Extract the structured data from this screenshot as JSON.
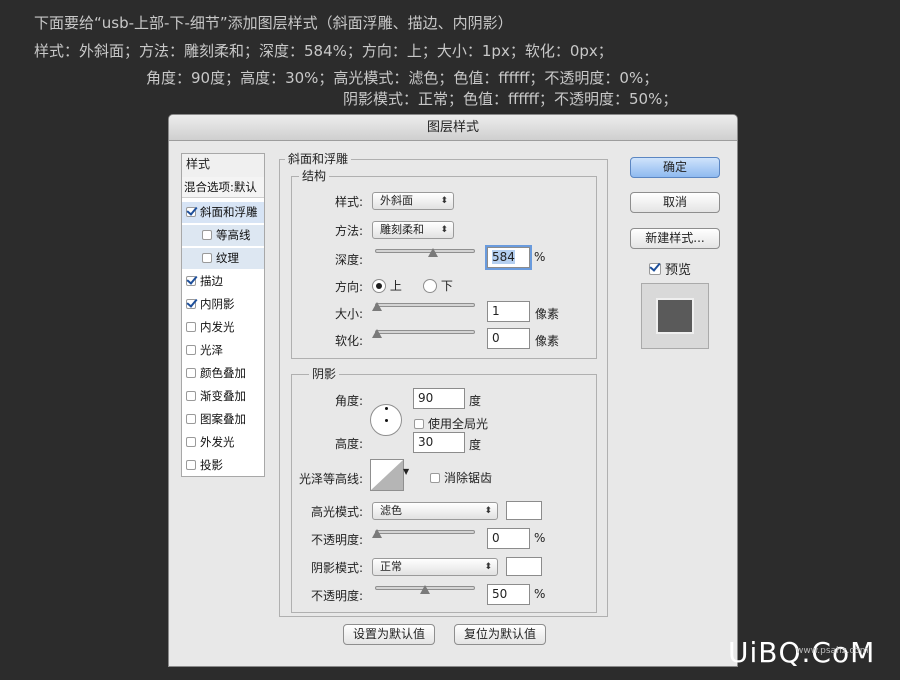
{
  "instructions": [
    "下面要给“usb-上部-下-细节”添加图层样式（斜面浮雕、描边、内阴影）",
    "样式：外斜面；方法：雕刻柔和；深度：584%；方向：上；大小：1px；软化：0px；",
    "角度：90度；高度：30%；高光模式：滤色；色值：ffffff；不透明度：0%；",
    "阴影模式：正常；色值：ffffff；不透明度：50%；"
  ],
  "dialog": {
    "title": "图层样式",
    "sidebar": {
      "header": "样式",
      "items": [
        {
          "label": "混合选项:默认",
          "checkbox": false,
          "checked": false
        },
        {
          "label": "斜面和浮雕",
          "checkbox": true,
          "checked": true
        },
        {
          "label": "等高线",
          "checkbox": true,
          "checked": false
        },
        {
          "label": "纹理",
          "checkbox": true,
          "checked": false
        },
        {
          "label": "描边",
          "checkbox": true,
          "checked": true
        },
        {
          "label": "内阴影",
          "checkbox": true,
          "checked": true
        },
        {
          "label": "内发光",
          "checkbox": true,
          "checked": false
        },
        {
          "label": "光泽",
          "checkbox": true,
          "checked": false
        },
        {
          "label": "颜色叠加",
          "checkbox": true,
          "checked": false
        },
        {
          "label": "渐变叠加",
          "checkbox": true,
          "checked": false
        },
        {
          "label": "图案叠加",
          "checkbox": true,
          "checked": false
        },
        {
          "label": "外发光",
          "checkbox": true,
          "checked": false
        },
        {
          "label": "投影",
          "checkbox": true,
          "checked": false
        }
      ]
    },
    "bevel": {
      "title": "斜面和浮雕",
      "structure_title": "结构",
      "style_label": "样式:",
      "style_value": "外斜面",
      "technique_label": "方法:",
      "technique_value": "雕刻柔和",
      "depth_label": "深度:",
      "depth_value": "584",
      "depth_slider": 0.58,
      "percent": "%",
      "direction_label": "方向:",
      "dir_up": "上",
      "dir_down": "下",
      "size_label": "大小:",
      "size_value": "1",
      "size_unit": "像素",
      "soften_label": "软化:",
      "soften_value": "0",
      "soften_unit": "像素"
    },
    "shading": {
      "title": "阴影",
      "angle_label": "角度:",
      "angle_value": "90",
      "angle_unit": "度",
      "global_light": "使用全局光",
      "altitude_label": "高度:",
      "altitude_value": "30",
      "altitude_unit": "度",
      "gloss_label": "光泽等高线:",
      "antialias": "消除锯齿",
      "highlight_label": "高光模式:",
      "highlight_value": "滤色",
      "highlight_color": "#ffffff",
      "hl_opacity_label": "不透明度:",
      "hl_opacity_value": "0",
      "hl_opacity_slider": 0.0,
      "shadow_label": "阴影模式:",
      "shadow_value": "正常",
      "shadow_color": "#ffffff",
      "sh_opacity_label": "不透明度:",
      "sh_opacity_value": "50",
      "sh_opacity_slider": 0.5,
      "percent": "%"
    },
    "buttons": {
      "make_default": "设置为默认值",
      "reset_default": "复位为默认值",
      "ok": "确定",
      "cancel": "取消",
      "new_style": "新建样式...",
      "preview": "预览"
    }
  },
  "watermark": {
    "text": "UiBQ.CoM",
    "small": "www.psahz.com"
  }
}
